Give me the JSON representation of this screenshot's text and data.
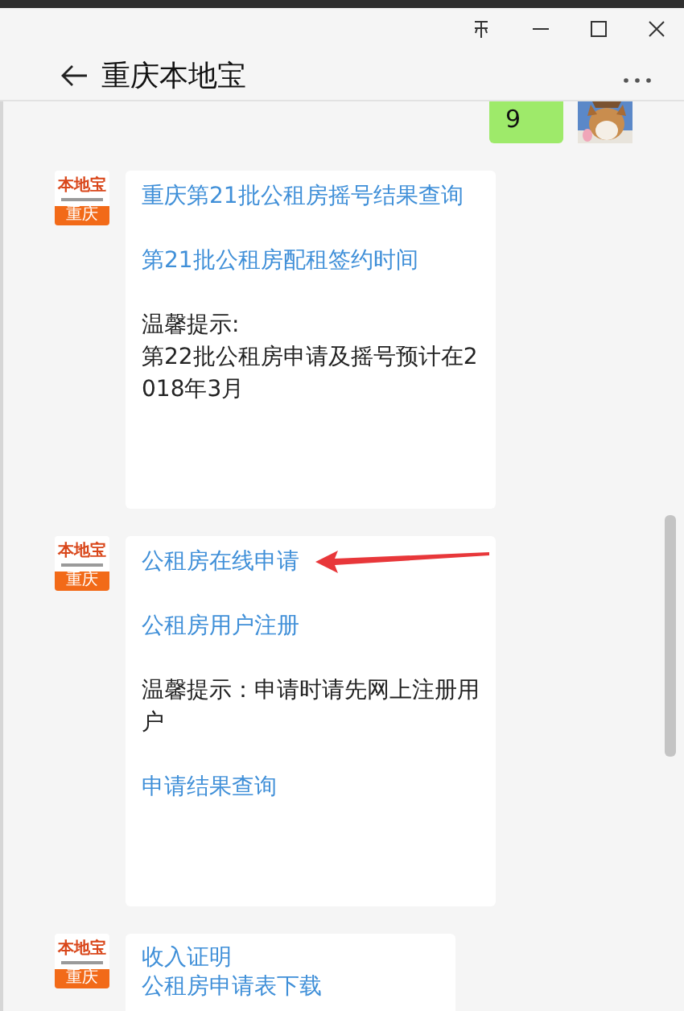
{
  "window": {
    "title": "重庆本地宝"
  },
  "messages": [
    {
      "kind": "text",
      "text": "9"
    },
    {
      "kind": "card",
      "badge": {
        "top": "本地宝",
        "bottom": "重庆"
      },
      "paragraphs": [
        [
          {
            "kind": "link",
            "text": "重庆第21批公租房摇号结果查询"
          }
        ],
        [
          {
            "kind": "link",
            "text": "第21批公租房配租签约时间"
          }
        ],
        [
          {
            "kind": "text",
            "text": "温馨提示:"
          },
          {
            "kind": "text",
            "text": "第22批公租房申请及摇号预计在2018年3月"
          }
        ]
      ]
    },
    {
      "kind": "card",
      "badge": {
        "top": "本地宝",
        "bottom": "重庆"
      },
      "paragraphs": [
        [
          {
            "kind": "link",
            "text": "公租房在线申请",
            "pointer": true
          }
        ],
        [
          {
            "kind": "link",
            "text": "公租房用户注册"
          }
        ],
        [
          {
            "kind": "text",
            "text": "温馨提示：申请时请先网上注册用户"
          }
        ],
        [
          {
            "kind": "link",
            "text": "申请结果查询"
          }
        ]
      ]
    },
    {
      "kind": "card",
      "badge": {
        "top": "本地宝",
        "bottom": "重庆"
      },
      "paragraphs": [
        [
          {
            "kind": "link",
            "text": "收入证明"
          },
          {
            "kind": "link",
            "text": "公租房申请表下载"
          }
        ]
      ]
    }
  ]
}
